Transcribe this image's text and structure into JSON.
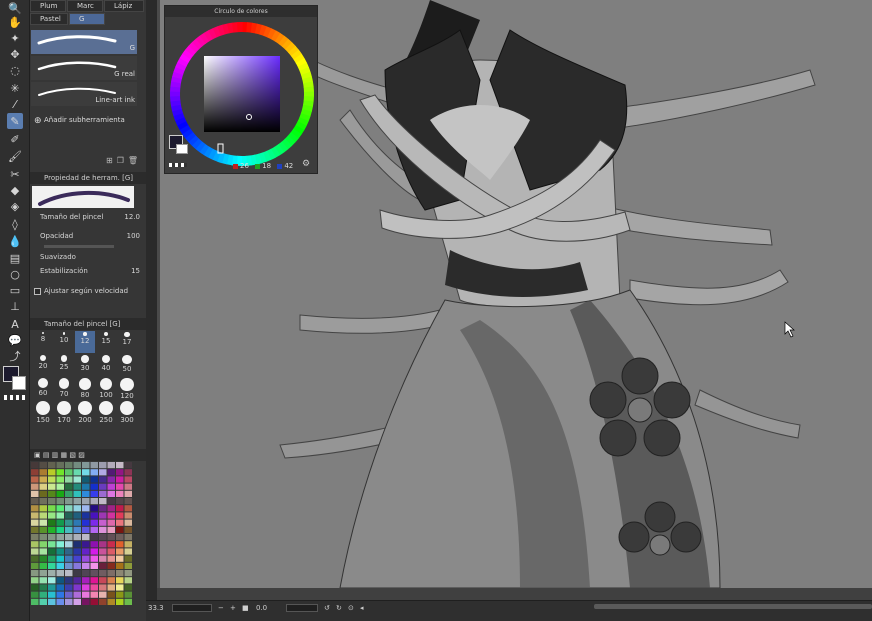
{
  "subtool_tabs": {
    "row1": [
      "Plum",
      "Marc",
      "Lápiz"
    ],
    "row2": [
      "Pastel",
      "G"
    ]
  },
  "brushes": [
    {
      "label": "G"
    },
    {
      "label": "G real"
    },
    {
      "label": "Line-art ink"
    }
  ],
  "add_subtool": "Añadir subherramienta",
  "tool_property": {
    "header": "Propiedad de herram. [G]",
    "brush_size_label": "Tamaño del pincel",
    "brush_size_value": "12.0",
    "opacity_label": "Opacidad",
    "opacity_value": "100",
    "smoothing_label": "Suavizado",
    "stabilization_label": "Estabilización",
    "stabilization_value": "15",
    "speed_label": "Ajustar según velocidad"
  },
  "brush_size_panel": {
    "header": "Tamaño del pincel [G]",
    "sizes": [
      "8",
      "10",
      "12",
      "15",
      "17",
      "20",
      "25",
      "30",
      "40",
      "50",
      "60",
      "70",
      "80",
      "100",
      "120",
      "150",
      "170",
      "200",
      "250",
      "300"
    ],
    "selected": "12"
  },
  "color_wheel": {
    "title": "Círculo de colores",
    "r": "26",
    "g": "18",
    "b": "42",
    "main_color": "#1c1a2e"
  },
  "status": {
    "zoom": "33.3",
    "rotation": "0.0"
  },
  "colors": {
    "accent": "#5a7db0",
    "canvas_bg": "#7d7d7d"
  }
}
